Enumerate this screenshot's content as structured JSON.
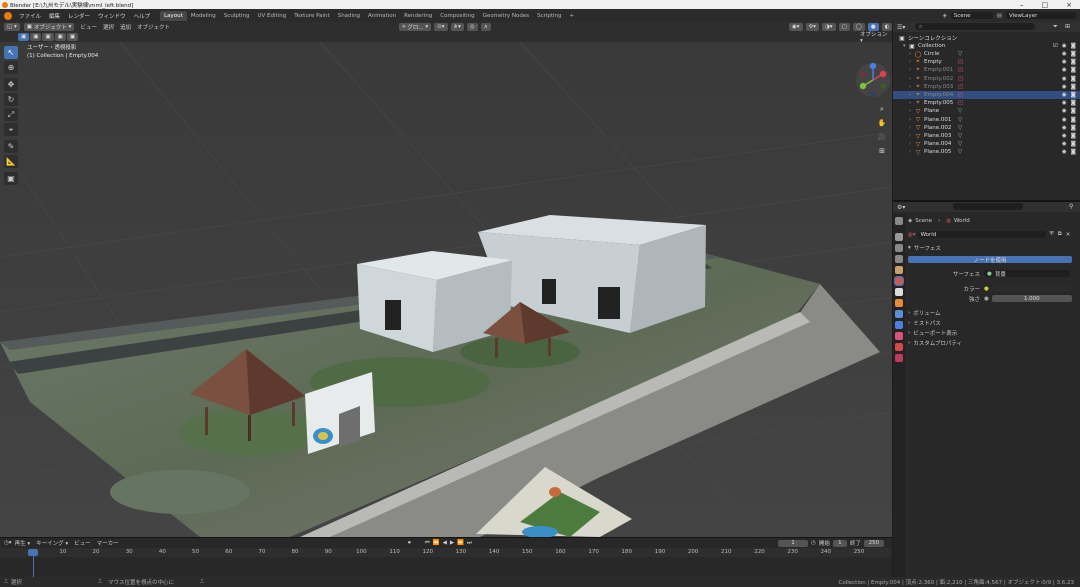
{
  "window": {
    "title": "Blender [E:\\九州モデル\\実験棟\\mml_left.blend]"
  },
  "menu": {
    "items": [
      "ファイル",
      "編集",
      "レンダー",
      "ウィンドウ",
      "ヘルプ"
    ]
  },
  "workspaces": {
    "tabs": [
      "Layout",
      "Modeling",
      "Sculpting",
      "UV Editing",
      "Texture Paint",
      "Shading",
      "Animation",
      "Rendering",
      "Compositing",
      "Geometry Nodes",
      "Scripting"
    ],
    "active": "Layout",
    "add": "+"
  },
  "scene": {
    "icon": "scene-icon",
    "name": "Scene",
    "view_layer": "ViewLayer"
  },
  "viewport": {
    "mode": "オブジェクト",
    "menus": [
      "ビュー",
      "選択",
      "追加",
      "オブジェクト"
    ],
    "transform": "グロ...",
    "options": "オプション",
    "overlay_title": "ユーザー・透視投影",
    "overlay_sub": "(1) Collection | Empty.004"
  },
  "outliner": {
    "root": "シーンコレクション",
    "collection": "Collection",
    "items": [
      {
        "name": "Circle",
        "icon": "curve-icon",
        "color": "#e8893a",
        "sub": "▽",
        "subcolor": "#7bd48a"
      },
      {
        "name": "Empty",
        "icon": "empty-icon",
        "color": "#e8893a",
        "sub": "◰",
        "subcolor": "#e05a78"
      },
      {
        "name": "Empty.001",
        "icon": "empty-icon",
        "color": "#e8893a",
        "sub": "◰",
        "subcolor": "#e05a78",
        "dim": true
      },
      {
        "name": "Empty.002",
        "icon": "empty-icon",
        "color": "#e8893a",
        "sub": "◰",
        "subcolor": "#e05a78",
        "dim": true
      },
      {
        "name": "Empty.003",
        "icon": "empty-icon",
        "color": "#e8893a",
        "sub": "◰",
        "subcolor": "#e05a78",
        "dim": true
      },
      {
        "name": "Empty.004",
        "icon": "empty-icon",
        "color": "#e8893a",
        "sub": "◰",
        "subcolor": "#e05a78",
        "dim": true,
        "selected": true
      },
      {
        "name": "Empty.005",
        "icon": "empty-icon",
        "color": "#e8893a",
        "sub": "◰",
        "subcolor": "#e05a78"
      },
      {
        "name": "Plane",
        "icon": "mesh-icon",
        "color": "#e8893a",
        "sub": "▽",
        "subcolor": "#7bd48a"
      },
      {
        "name": "Plane.001",
        "icon": "mesh-icon",
        "color": "#e8893a",
        "sub": "▽",
        "subcolor": "#7bd48a"
      },
      {
        "name": "Plane.002",
        "icon": "mesh-icon",
        "color": "#e8893a",
        "sub": "▽",
        "subcolor": "#7bd48a"
      },
      {
        "name": "Plane.003",
        "icon": "mesh-icon",
        "color": "#e8893a",
        "sub": "▽",
        "subcolor": "#7bd48a"
      },
      {
        "name": "Plane.004",
        "icon": "mesh-icon",
        "color": "#e8893a",
        "sub": "▽",
        "subcolor": "#7bd48a"
      },
      {
        "name": "Plane.005",
        "icon": "mesh-icon",
        "color": "#e8893a",
        "sub": "▽",
        "subcolor": "#7bd48a"
      }
    ]
  },
  "properties": {
    "breadcrumb_scene": "Scene",
    "breadcrumb_world": "World",
    "world_name": "World",
    "surface_panel": "サーフェス",
    "use_nodes": "ノードを使用",
    "surface_label": "サーフェス",
    "surface_value": "背景",
    "color_label": "カラー",
    "strength_label": "強さ",
    "strength_value": "1.000",
    "panels": [
      "ボリューム",
      "ミストパス",
      "ビューポート表示",
      "カスタムプロパティ"
    ]
  },
  "timeline": {
    "menus": [
      "再生",
      "キーイング",
      "ビュー",
      "マーカー"
    ],
    "current_frame": "1",
    "start_label": "開始",
    "start": "1",
    "end_label": "終了",
    "end": "250",
    "ticks": [
      "1",
      "10",
      "20",
      "30",
      "40",
      "50",
      "60",
      "70",
      "80",
      "90",
      "100",
      "110",
      "120",
      "130",
      "140",
      "150",
      "160",
      "170",
      "180",
      "190",
      "200",
      "210",
      "220",
      "230",
      "240",
      "250"
    ]
  },
  "status": {
    "left": "選択",
    "mid": "マウス位置を視点の中心に",
    "right": "Collection | Empty.004 | 頂点:2,360 | 面:2,210 | 三角面:4,567 | オブジェクト:0/9 | 3.6.23"
  },
  "colors": {
    "accent": "#4772b3",
    "selection": "#334d80",
    "orange": "#e8893a"
  }
}
